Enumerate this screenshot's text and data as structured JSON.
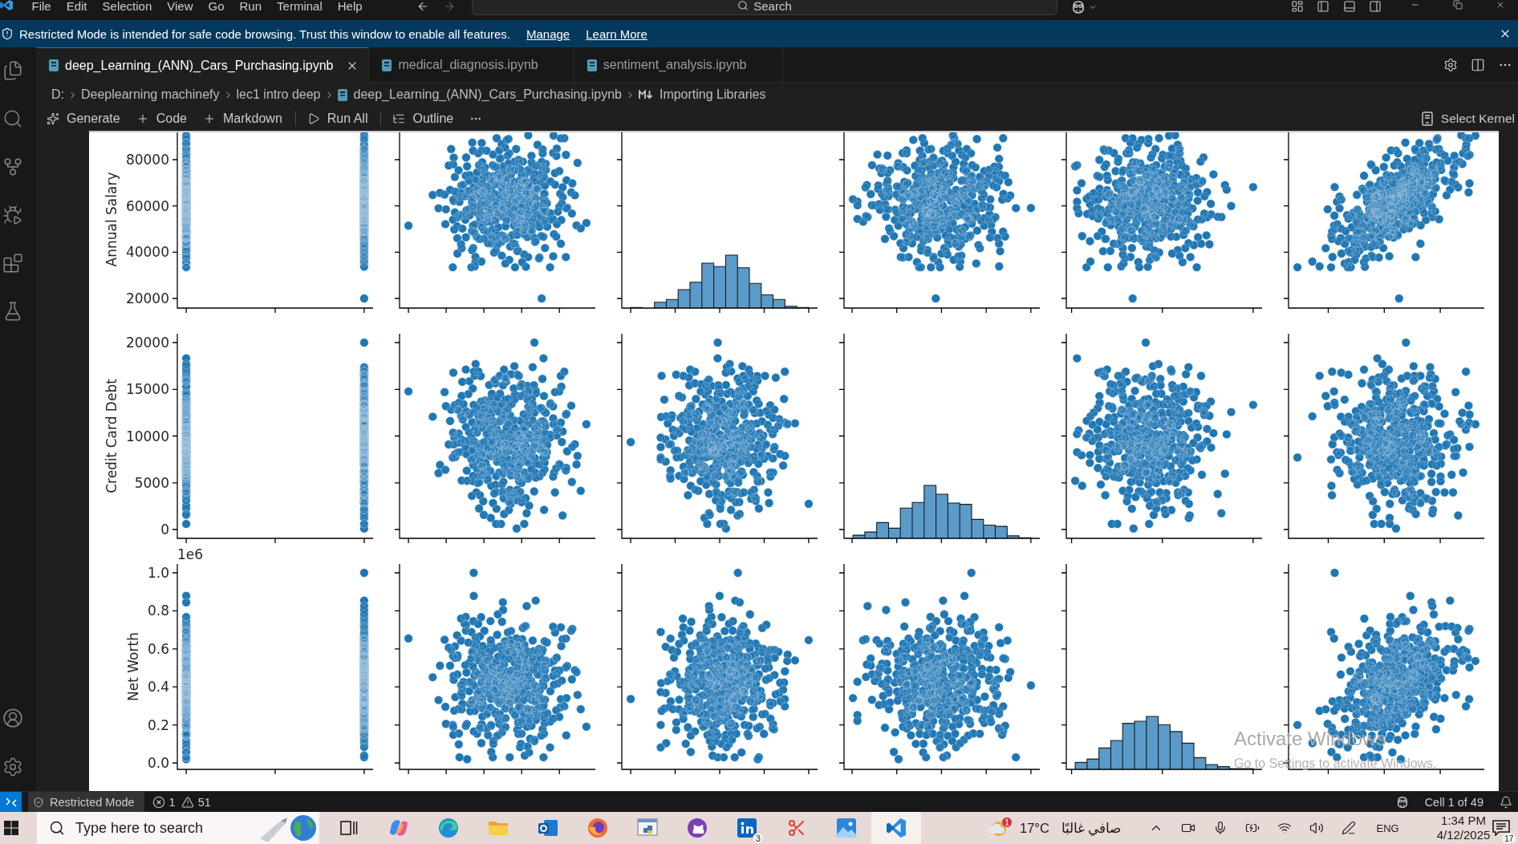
{
  "title_bar": {
    "menu": [
      "File",
      "Edit",
      "Selection",
      "View",
      "Go",
      "Run",
      "Terminal",
      "Help"
    ],
    "nav": [
      {
        "disabled": false
      },
      {
        "disabled": true
      }
    ],
    "command_center": "Search"
  },
  "banner": {
    "message": "Restricted Mode is intended for safe code browsing. Trust this window to enable all features.",
    "links": [
      "Manage",
      "Learn More"
    ]
  },
  "tabs": [
    {
      "label": "deep_Learning_(ANN)_Cars_Purchasing.ipynb",
      "selected": true
    },
    {
      "label": "medical_diagnosis.ipynb",
      "selected": false
    },
    {
      "label": "sentiment_analysis.ipynb",
      "selected": false
    }
  ],
  "breadcrumb": [
    {
      "label": "D:",
      "kind": "folder"
    },
    {
      "label": "Deeplearning machinefy",
      "kind": "folder"
    },
    {
      "label": "lec1 intro deep",
      "kind": "folder"
    },
    {
      "label": "deep_Learning_(ANN)_Cars_Purchasing.ipynb",
      "kind": "notebook"
    },
    {
      "label": "Importing Libraries",
      "kind": "section"
    }
  ],
  "toolbar": {
    "groups": [
      [
        "Generate",
        "Code",
        "Markdown"
      ],
      [
        "Run All"
      ],
      [
        "Outline"
      ]
    ],
    "kernel": "Select Kernel"
  },
  "pair_plot": {
    "rows": [
      {
        "label": "Annual Salary",
        "ticks": [
          "80000",
          "60000",
          "40000",
          "20000"
        ],
        "panels": [
          {
            "kind": "scatter"
          },
          {
            "kind": "scatter"
          },
          {
            "kind": "hist"
          },
          {
            "kind": "scatter"
          },
          {
            "kind": "scatter"
          },
          {
            "kind": "scatter"
          }
        ]
      },
      {
        "label": "Credit Card Debt",
        "ticks": [
          "20000",
          "15000",
          "10000",
          "5000",
          "0"
        ],
        "panels": [
          {
            "kind": "scatter"
          },
          {
            "kind": "scatter"
          },
          {
            "kind": "scatter"
          },
          {
            "kind": "hist"
          },
          {
            "kind": "scatter"
          },
          {
            "kind": "scatter"
          }
        ]
      },
      {
        "label": "Net Worth",
        "offset": "1e6",
        "ticks": [
          "1.0",
          "0.8",
          "0.6",
          "0.4",
          "0.2",
          "0.0"
        ],
        "panels": [
          {
            "kind": "scatter"
          },
          {
            "kind": "scatter"
          },
          {
            "kind": "scatter"
          },
          {
            "kind": "scatter"
          },
          {
            "kind": "hist"
          },
          {
            "kind": "scatter"
          }
        ]
      }
    ]
  },
  "activation_notice": {
    "title": "Activate Windows",
    "hint": "Go to Settings to activate Windows."
  },
  "status_bar": {
    "mode": "Restricted Mode",
    "errors": "1",
    "warnings": "51",
    "cell": "Cell 1 of 49"
  },
  "taskbar": {
    "search": {
      "placeholder": "Type here to search"
    },
    "apps": [
      {
        "active": false
      },
      {
        "active": false
      },
      {
        "active": false
      },
      {
        "active": false
      },
      {
        "active": false
      },
      {
        "active": false
      },
      {
        "active": false
      },
      {
        "active": false
      },
      {
        "active": false,
        "badge": "3"
      },
      {
        "active": false
      },
      {
        "active": false
      },
      {
        "active": true
      }
    ],
    "weather": {
      "badge": "1",
      "temperature": "17°C",
      "condition": "صافي غالبًا"
    },
    "language": "ENG",
    "time": "1:34 PM",
    "date": "4/12/2025",
    "notifications": "17"
  }
}
